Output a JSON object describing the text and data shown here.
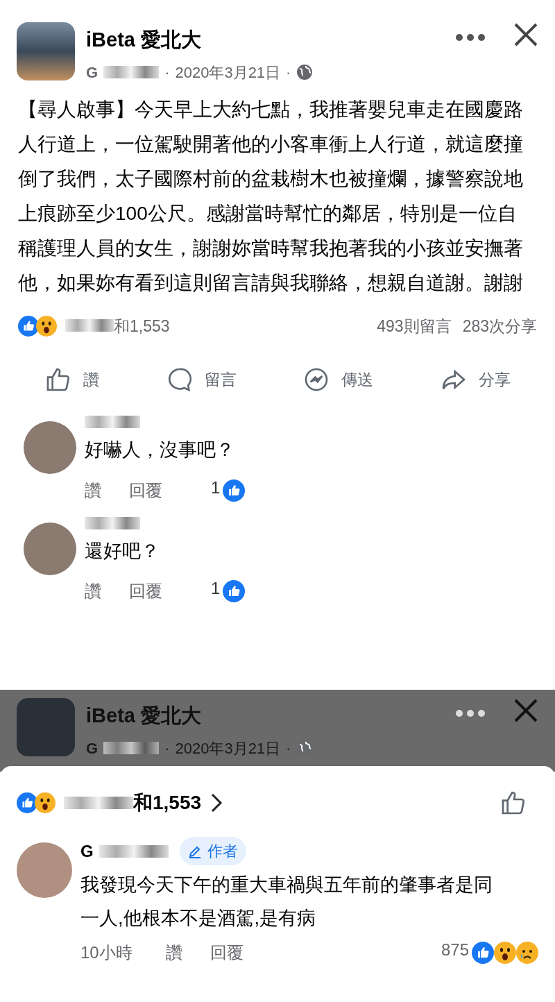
{
  "post": {
    "page_name": "iBeta 愛北大",
    "author_initial": "G",
    "date": "2020年3月21日",
    "separator": "·",
    "body": "【尋人啟事】今天早上大約七點，我推著嬰兒車走在國慶路人行道上，一位駕駛開著他的小客車衝上人行道，就這麼撞倒了我們，太子國際村前的盆栽樹木也被撞爛，據警察說地上痕跡至少100公尺。感謝當時幫忙的鄰居，特別是一位自稱護理人員的女生，謝謝妳當時幫我抱著我的小孩並安撫著他，如果妳有看到這則留言請與我聯絡，想親自道謝。謝謝",
    "reactions_text": "和1,553",
    "comments_count": "493則留言",
    "shares_count": "283次分享",
    "actions": [
      {
        "kind": "like",
        "label": "讚"
      },
      {
        "kind": "comment",
        "label": "留言"
      },
      {
        "kind": "send",
        "label": "傳送"
      },
      {
        "kind": "share",
        "label": "分享"
      }
    ]
  },
  "comments": [
    {
      "text": "好嚇人，沒事吧？",
      "like": "讚",
      "reply": "回覆",
      "likes": "1"
    },
    {
      "text": "還好吧？",
      "like": "讚",
      "reply": "回覆",
      "likes": "1"
    }
  ],
  "overlay_header": {
    "page_name": "iBeta 愛北大",
    "author_initial": "G",
    "date": "2020年3月21日",
    "separator": "·"
  },
  "sheet": {
    "reactions_text": "和1,553",
    "comment": {
      "author_initial": "G",
      "badge": "作者",
      "text": "我發現今天下午的重大車禍與五年前的肇事者是同一人,他根本不是酒駕,是有病",
      "time": "10小時",
      "like": "讚",
      "reply": "回覆",
      "count": "875"
    }
  }
}
